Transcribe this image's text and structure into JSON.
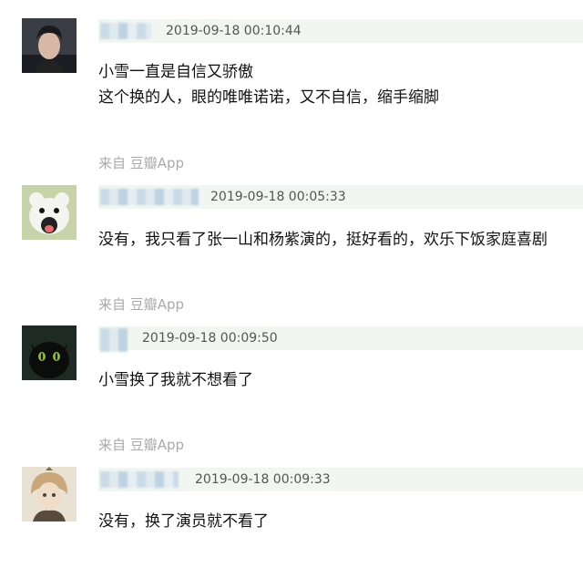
{
  "comments": [
    {
      "timestamp": "2019-09-18 00:10:44",
      "lines": [
        "小雪一直是自信又骄傲",
        "这个换的人，眼的唯唯诺诺，又不自信，缩手缩脚"
      ],
      "avatar_icon": "man-portrait-avatar"
    },
    {
      "source": "来自 豆瓣App",
      "timestamp": "2019-09-18 00:05:33",
      "lines": [
        "没有，我只看了张一山和杨紫演的，挺好看的，欢乐下饭家庭喜剧"
      ],
      "avatar_icon": "polar-bear-avatar"
    },
    {
      "source": "来自 豆瓣App",
      "timestamp": "2019-09-18 00:09:50",
      "lines": [
        "小雪换了我就不想看了"
      ],
      "avatar_icon": "black-dragon-avatar"
    },
    {
      "source": "来自 豆瓣App",
      "timestamp": "2019-09-18 00:09:33",
      "lines": [
        "没有，换了演员就不看了"
      ],
      "avatar_icon": "anime-character-avatar"
    }
  ],
  "colors": {
    "meta_bar_bg": "#f1f6f2",
    "source_text": "#aaaaaa",
    "body_text": "#111111",
    "time_text": "#555555"
  }
}
